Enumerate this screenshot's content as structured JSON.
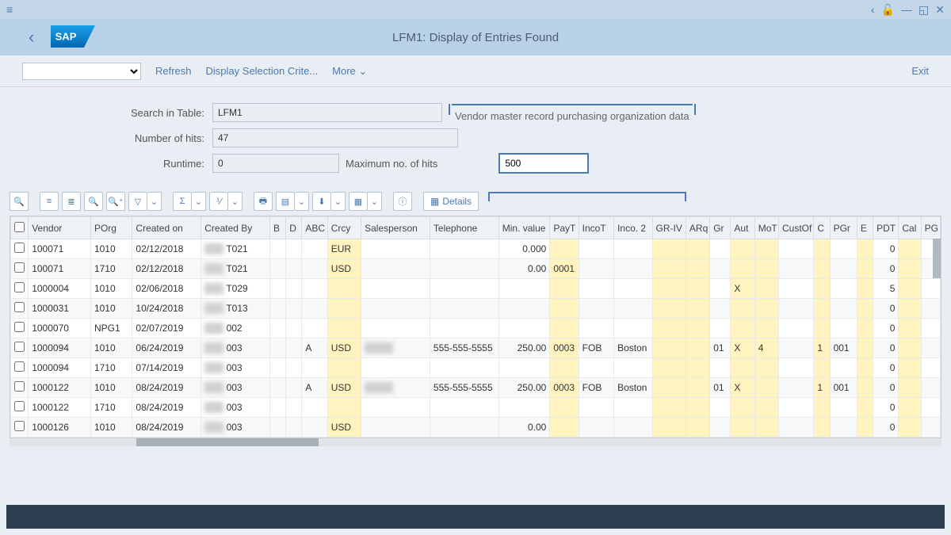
{
  "titlebar": {
    "hamburger": "≡"
  },
  "header": {
    "title": "LFM1: Display of Entries Found"
  },
  "toolbar": {
    "refresh": "Refresh",
    "display_sel": "Display Selection Crite...",
    "more": "More",
    "exit": "Exit"
  },
  "form": {
    "search_label": "Search in Table:",
    "search_value": "LFM1",
    "search_desc": "Vendor master record purchasing organization data",
    "hits_label": "Number of hits:",
    "hits_value": "47",
    "runtime_label": "Runtime:",
    "runtime_value": "0",
    "max_label": "Maximum no. of hits",
    "max_value": "500"
  },
  "details_label": "Details",
  "columns": [
    "",
    "Vendor",
    "POrg",
    "Created on",
    "Created By",
    "B",
    "D",
    "ABC",
    "Crcy",
    "Salesperson",
    "Telephone",
    "Min. value",
    "PayT",
    "IncoT",
    "Inco. 2",
    "GR-IV",
    "ARq",
    "Gr",
    "Aut",
    "MoT",
    "CustOf",
    "C",
    "PGr",
    "E",
    "PDT",
    "Cal",
    "PG"
  ],
  "rows": [
    {
      "vendor": "100071",
      "porg": "1010",
      "created_on": "02/12/2018",
      "created_by": "T021",
      "b": "",
      "d": "",
      "abc": "",
      "crcy": "EUR",
      "sales": "",
      "tel": "",
      "min": "0.000",
      "payt": "",
      "incot": "",
      "inco2": "",
      "griv": "",
      "arq": "",
      "gr": "",
      "aut": "",
      "mot": "",
      "custof": "",
      "c": "",
      "pgr": "",
      "e": "",
      "pdt": "0",
      "cal": "",
      "pg": ""
    },
    {
      "vendor": "100071",
      "porg": "1710",
      "created_on": "02/12/2018",
      "created_by": "T021",
      "b": "",
      "d": "",
      "abc": "",
      "crcy": "USD",
      "sales": "",
      "tel": "",
      "min": "0.00",
      "payt": "0001",
      "incot": "",
      "inco2": "",
      "griv": "",
      "arq": "",
      "gr": "",
      "aut": "",
      "mot": "",
      "custof": "",
      "c": "",
      "pgr": "",
      "e": "",
      "pdt": "0",
      "cal": "",
      "pg": ""
    },
    {
      "vendor": "1000004",
      "porg": "1010",
      "created_on": "02/06/2018",
      "created_by": "T029",
      "b": "",
      "d": "",
      "abc": "",
      "crcy": "",
      "sales": "",
      "tel": "",
      "min": "",
      "payt": "",
      "incot": "",
      "inco2": "",
      "griv": "",
      "arq": "",
      "gr": "",
      "aut": "X",
      "mot": "",
      "custof": "",
      "c": "",
      "pgr": "",
      "e": "",
      "pdt": "5",
      "cal": "",
      "pg": ""
    },
    {
      "vendor": "1000031",
      "porg": "1010",
      "created_on": "10/24/2018",
      "created_by": "T013",
      "b": "",
      "d": "",
      "abc": "",
      "crcy": "",
      "sales": "",
      "tel": "",
      "min": "",
      "payt": "",
      "incot": "",
      "inco2": "",
      "griv": "",
      "arq": "",
      "gr": "",
      "aut": "",
      "mot": "",
      "custof": "",
      "c": "",
      "pgr": "",
      "e": "",
      "pdt": "0",
      "cal": "",
      "pg": ""
    },
    {
      "vendor": "1000070",
      "porg": "NPG1",
      "created_on": "02/07/2019",
      "created_by": "002",
      "b": "",
      "d": "",
      "abc": "",
      "crcy": "",
      "sales": "",
      "tel": "",
      "min": "",
      "payt": "",
      "incot": "",
      "inco2": "",
      "griv": "",
      "arq": "",
      "gr": "",
      "aut": "",
      "mot": "",
      "custof": "",
      "c": "",
      "pgr": "",
      "e": "",
      "pdt": "0",
      "cal": "",
      "pg": ""
    },
    {
      "vendor": "1000094",
      "porg": "1010",
      "created_on": "06/24/2019",
      "created_by": "003",
      "b": "",
      "d": "",
      "abc": "A",
      "crcy": "USD",
      "sales": "xxx",
      "tel": "555-555-5555",
      "min": "250.00",
      "payt": "0003",
      "incot": "FOB",
      "inco2": "Boston",
      "griv": "",
      "arq": "",
      "gr": "01",
      "aut": "X",
      "mot": "4",
      "custof": "",
      "c": "1",
      "pgr": "001",
      "e": "",
      "pdt": "0",
      "cal": "",
      "pg": ""
    },
    {
      "vendor": "1000094",
      "porg": "1710",
      "created_on": "07/14/2019",
      "created_by": "003",
      "b": "",
      "d": "",
      "abc": "",
      "crcy": "",
      "sales": "",
      "tel": "",
      "min": "",
      "payt": "",
      "incot": "",
      "inco2": "",
      "griv": "",
      "arq": "",
      "gr": "",
      "aut": "",
      "mot": "",
      "custof": "",
      "c": "",
      "pgr": "",
      "e": "",
      "pdt": "0",
      "cal": "",
      "pg": ""
    },
    {
      "vendor": "1000122",
      "porg": "1010",
      "created_on": "08/24/2019",
      "created_by": "003",
      "b": "",
      "d": "",
      "abc": "A",
      "crcy": "USD",
      "sales": "xxx",
      "tel": "555-555-5555",
      "min": "250.00",
      "payt": "0003",
      "incot": "FOB",
      "inco2": "Boston",
      "griv": "",
      "arq": "",
      "gr": "01",
      "aut": "X",
      "mot": "",
      "custof": "",
      "c": "1",
      "pgr": "001",
      "e": "",
      "pdt": "0",
      "cal": "",
      "pg": ""
    },
    {
      "vendor": "1000122",
      "porg": "1710",
      "created_on": "08/24/2019",
      "created_by": "003",
      "b": "",
      "d": "",
      "abc": "",
      "crcy": "",
      "sales": "",
      "tel": "",
      "min": "",
      "payt": "",
      "incot": "",
      "inco2": "",
      "griv": "",
      "arq": "",
      "gr": "",
      "aut": "",
      "mot": "",
      "custof": "",
      "c": "",
      "pgr": "",
      "e": "",
      "pdt": "0",
      "cal": "",
      "pg": ""
    },
    {
      "vendor": "1000126",
      "porg": "1010",
      "created_on": "08/24/2019",
      "created_by": "003",
      "b": "",
      "d": "",
      "abc": "",
      "crcy": "USD",
      "sales": "",
      "tel": "",
      "min": "0.00",
      "payt": "",
      "incot": "",
      "inco2": "",
      "griv": "",
      "arq": "",
      "gr": "",
      "aut": "",
      "mot": "",
      "custof": "",
      "c": "",
      "pgr": "",
      "e": "",
      "pdt": "0",
      "cal": "",
      "pg": ""
    }
  ]
}
